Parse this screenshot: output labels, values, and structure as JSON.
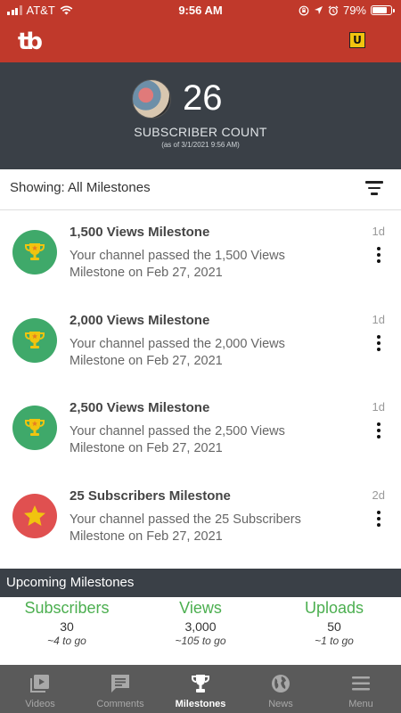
{
  "status_bar": {
    "carrier": "AT&T",
    "time": "9:56 AM",
    "battery": "79%"
  },
  "app_bar": {
    "logo_text": "tb",
    "badge_letter": "U"
  },
  "subscriber": {
    "count": "26",
    "label": "SUBSCRIBER COUNT",
    "as_of": "(as of 3/1/2021 9:56 AM)"
  },
  "filter": {
    "text": "Showing: All Milestones"
  },
  "milestones": [
    {
      "title": "1,500 Views Milestone",
      "description": "Your channel passed the 1,500 Views Milestone on Feb 27, 2021",
      "time": "1d",
      "icon": "trophy-icon",
      "color": "#3fa96a"
    },
    {
      "title": "2,000 Views Milestone",
      "description": "Your channel passed the 2,000 Views Milestone on Feb 27, 2021",
      "time": "1d",
      "icon": "trophy-icon",
      "color": "#3fa96a"
    },
    {
      "title": "2,500 Views Milestone",
      "description": "Your channel passed the 2,500 Views Milestone on Feb 27, 2021",
      "time": "1d",
      "icon": "trophy-icon",
      "color": "#3fa96a"
    },
    {
      "title": "25 Subscribers Milestone",
      "description": "Your channel passed the 25 Subscribers Milestone on Feb 27, 2021",
      "time": "2d",
      "icon": "star-icon",
      "color": "#e05050"
    }
  ],
  "upcoming": {
    "title": "Upcoming Milestones",
    "items": [
      {
        "label": "Subscribers",
        "value": "30",
        "to_go": "~4 to go"
      },
      {
        "label": "Views",
        "value": "3,000",
        "to_go": "~105 to go"
      },
      {
        "label": "Uploads",
        "value": "50",
        "to_go": "~1 to go"
      }
    ]
  },
  "nav": [
    {
      "label": "Videos",
      "icon": "video-icon",
      "active": false
    },
    {
      "label": "Comments",
      "icon": "comments-icon",
      "active": false
    },
    {
      "label": "Milestones",
      "icon": "trophy-icon",
      "active": true
    },
    {
      "label": "News",
      "icon": "globe-icon",
      "active": false
    },
    {
      "label": "Menu",
      "icon": "menu-icon",
      "active": false
    }
  ],
  "colors": {
    "brand_red": "#c0392b",
    "header_dark": "#3a4047",
    "accent_green": "#4caf50",
    "nav_bg": "#5a5a5a"
  }
}
